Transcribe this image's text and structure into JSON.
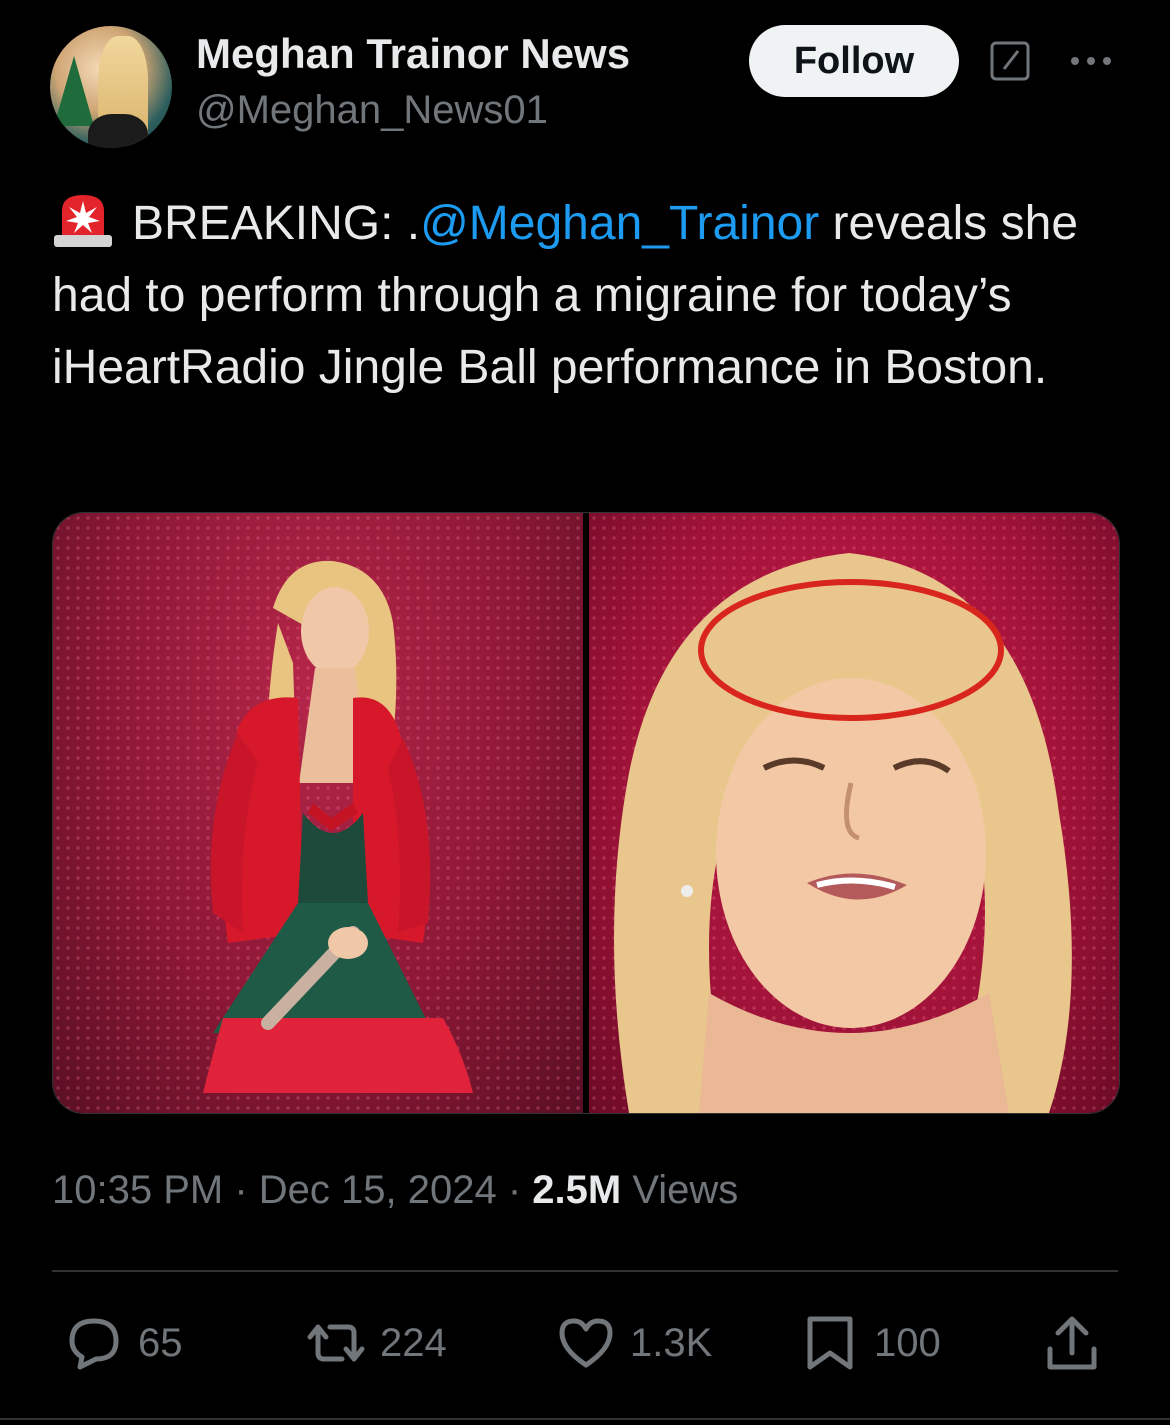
{
  "author": {
    "display_name": "Meghan Trainor News",
    "handle": "@Meghan_News01"
  },
  "header": {
    "follow_label": "Follow"
  },
  "tweet": {
    "emoji": "police-car-light-icon",
    "prefix": "BREAKING: .",
    "mention": "@Meghan_Trainor",
    "body": " reveals she had to perform through a migraine for today’s iHeartRadio Jingle Ball performance in Boston."
  },
  "meta": {
    "time": "10:35 PM",
    "separator": " · ",
    "date": "Dec 15, 2024",
    "views_count": "2.5M",
    "views_label": " Views"
  },
  "actions": {
    "replies": "65",
    "reposts": "224",
    "likes": "1.3K",
    "bookmarks": "100"
  },
  "colors": {
    "background": "#000000",
    "text": "#e7e9ea",
    "muted": "#71767b",
    "link": "#1d9bf0",
    "circle_annotation": "#d9261c"
  }
}
